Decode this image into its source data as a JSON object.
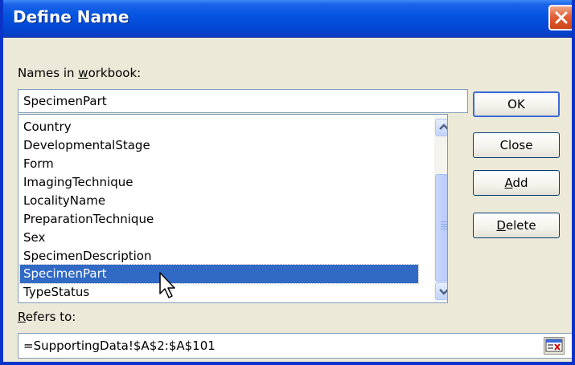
{
  "window": {
    "title": "Define Name"
  },
  "labels": {
    "names_prefix": "Names in ",
    "names_mnemonic": "w",
    "names_suffix": "orkbook:",
    "refers_mnemonic": "R",
    "refers_suffix": "efers to:"
  },
  "name_input": {
    "value": "SpecimenPart"
  },
  "names_list": {
    "items": [
      "Country",
      "DevelopmentalStage",
      "Form",
      "ImagingTechnique",
      "LocalityName",
      "PreparationTechnique",
      "Sex",
      "SpecimenDescription",
      "SpecimenPart",
      "TypeStatus"
    ],
    "selected": "SpecimenPart"
  },
  "buttons": {
    "ok": "OK",
    "close": "Close",
    "add_mnemonic": "A",
    "add_rest": "dd",
    "delete_mnemonic": "D",
    "delete_rest": "elete"
  },
  "refers_to": {
    "value": "=SupportingData!$A$2:$A$101"
  },
  "icons": {
    "close": "close-icon",
    "scroll_up": "arrow-up-icon",
    "scroll_down": "arrow-down-icon",
    "collapse": "collapse-dialog-icon",
    "cursor": "mouse-pointer-icon"
  },
  "colors": {
    "titlebar": "#0555e0",
    "selection": "#316ac5",
    "dialog_bg": "#ece9d8"
  }
}
